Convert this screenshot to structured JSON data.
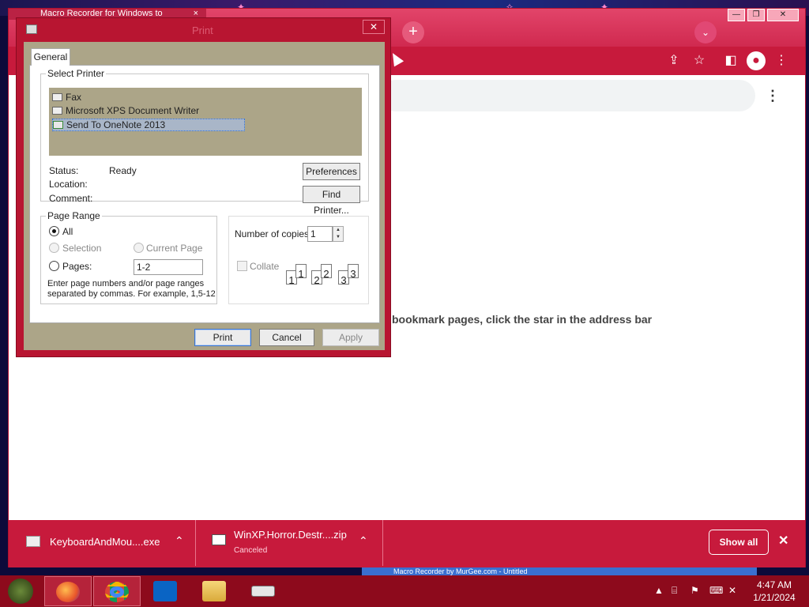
{
  "chrome": {
    "tab_title": "Macro Recorder for Windows to",
    "tab_close": "×",
    "new_tab": "+",
    "tab_search": "⌄",
    "minimize": "—",
    "maximize": "❐",
    "close": "✕",
    "toolbar_icons": [
      "share-icon",
      "star-icon",
      "sidepanel-icon",
      "profile-icon",
      "menu-icon"
    ],
    "ntp_menu": "⋮",
    "bookmark_hint": "bookmark pages, click the star in the address bar",
    "accent_color": "#c71a3c"
  },
  "downloads": {
    "items": [
      {
        "name": "KeyboardAndMou....exe",
        "status": "",
        "icon": "keyboard-icon"
      },
      {
        "name": "WinXP.Horror.Destr....zip",
        "status": "Canceled",
        "icon": "zip-icon"
      }
    ],
    "show_all": "Show all",
    "close": "✕",
    "chevron": "⌃"
  },
  "print_dialog": {
    "title": "Print",
    "close": "✕",
    "tab": "General",
    "select_printer_label": "Select Printer",
    "printers": [
      "Fax",
      "Microsoft XPS Document Writer",
      "Send To OneNote 2013"
    ],
    "selected_printer": "Send To OneNote 2013",
    "status_label": "Status:",
    "status_value": "Ready",
    "location_label": "Location:",
    "location_value": "",
    "comment_label": "Comment:",
    "comment_value": "",
    "preferences_button": "Preferences",
    "find_printer_button": "Find Printer...",
    "page_range_label": "Page Range",
    "all_label": "All",
    "selection_label": "Selection",
    "current_page_label": "Current Page",
    "pages_label": "Pages:",
    "pages_value": "1-2",
    "hint_line1": "Enter page numbers and/or page ranges",
    "hint_line2": "separated by commas.  For example, 1,5-12",
    "copies_label": "Number of copies:",
    "copies_value": "1",
    "spin_up": "▲",
    "spin_down": "▼",
    "collate_label": "Collate",
    "collate_pages": [
      "1",
      "1",
      "2",
      "2",
      "3",
      "3"
    ],
    "print_button": "Print",
    "cancel_button": "Cancel",
    "apply_button": "Apply"
  },
  "taskbar": {
    "apps": [
      "firefox-icon",
      "chrome-icon",
      "outlook-icon",
      "file-explorer-icon",
      "keyboard-icon"
    ],
    "tray_arrow": "▲",
    "time": "4:47 AM",
    "date": "1/21/2024",
    "behind_window_title": "Macro Recorder by MurGee.com - Untitled"
  }
}
